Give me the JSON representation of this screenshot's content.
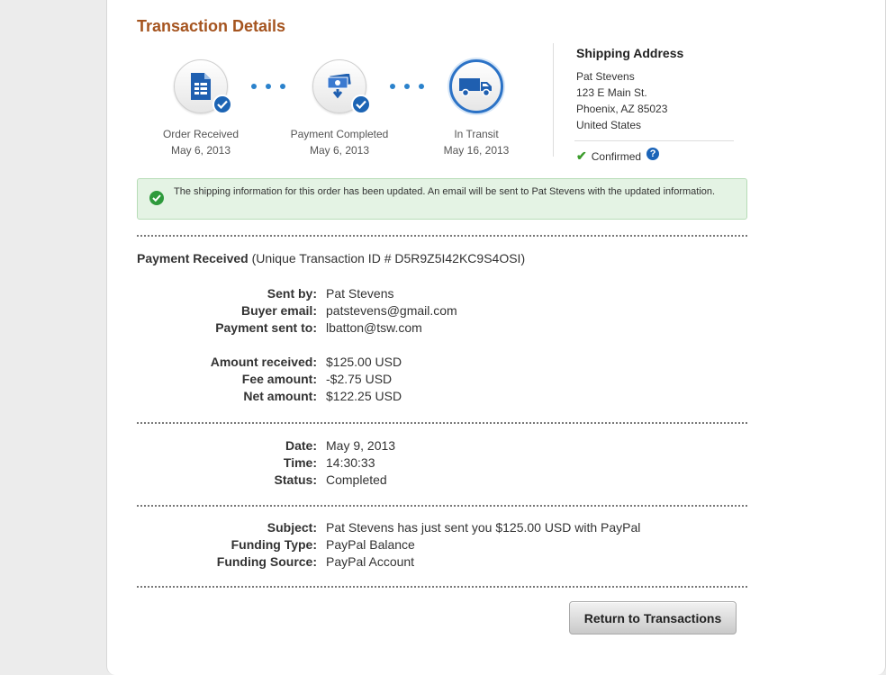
{
  "page": {
    "title": "Transaction Details"
  },
  "steps": [
    {
      "label": "Order Received",
      "date": "May 6, 2013",
      "icon": "order-document-icon",
      "completed": true
    },
    {
      "label": "Payment Completed",
      "date": "May 6, 2013",
      "icon": "payment-icon",
      "completed": true
    },
    {
      "label": "In Transit",
      "date": "May 16, 2013",
      "icon": "truck-icon",
      "completed": false,
      "current": true
    }
  ],
  "shipping": {
    "title": "Shipping Address",
    "name": "Pat Stevens",
    "street": "123 E Main St.",
    "city": "Phoenix, AZ 85023",
    "country": "United States",
    "status": "Confirmed"
  },
  "alert": {
    "text": "The shipping information for this order has been updated. An email will be sent to Pat Stevens with the updated information."
  },
  "payment": {
    "heading": "Payment Received",
    "transaction_id": "(Unique Transaction ID # D5R9Z5I42KC9S4OSI)"
  },
  "details": {
    "sent_by": {
      "label": "Sent by:",
      "value": "Pat Stevens"
    },
    "buyer_email": {
      "label": "Buyer email:",
      "value": "patstevens@gmail.com"
    },
    "payment_sent_to": {
      "label": "Payment sent to:",
      "value": "lbatton@tsw.com"
    },
    "amount_received": {
      "label": "Amount received:",
      "value": "$125.00 USD"
    },
    "fee_amount": {
      "label": "Fee amount:",
      "value": "-$2.75 USD"
    },
    "net_amount": {
      "label": "Net amount:",
      "value": "$122.25 USD"
    },
    "date": {
      "label": "Date:",
      "value": "May 9, 2013"
    },
    "time": {
      "label": "Time:",
      "value": "14:30:33"
    },
    "status": {
      "label": "Status:",
      "value": "Completed"
    },
    "subject": {
      "label": "Subject:",
      "value": "Pat Stevens has just sent you $125.00 USD with PayPal"
    },
    "funding_type": {
      "label": "Funding Type:",
      "value": "PayPal Balance"
    },
    "funding_source": {
      "label": "Funding Source:",
      "value": "PayPal Account"
    }
  },
  "actions": {
    "return_label": "Return to Transactions"
  },
  "colors": {
    "title": "#a5541f",
    "accent": "#2b72c6",
    "success": "#2e9a3c",
    "alert_bg": "#e4f3e4"
  }
}
